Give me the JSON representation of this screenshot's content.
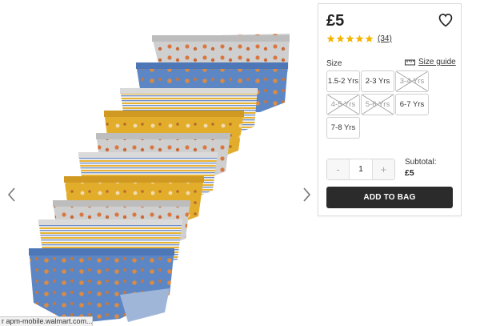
{
  "product": {
    "price": "£5",
    "rating": 5,
    "review_count": "(34)"
  },
  "size": {
    "label": "Size",
    "guide_label": "Size guide",
    "options": [
      {
        "label": "1.5-2 Yrs",
        "available": true
      },
      {
        "label": "2-3 Yrs",
        "available": true
      },
      {
        "label": "3-4 Yrs",
        "available": false
      },
      {
        "label": "4-5 Yrs",
        "available": false
      },
      {
        "label": "5-6 Yrs",
        "available": false
      },
      {
        "label": "6-7 Yrs",
        "available": true
      },
      {
        "label": "7-8 Yrs",
        "available": true
      }
    ]
  },
  "quantity": {
    "minus": "-",
    "value": "1",
    "plus": "+"
  },
  "subtotal": {
    "label": "Subtotal:",
    "value": "£5"
  },
  "add_to_bag_label": "ADD TO BAG",
  "status_bar_text": "r apm-mobile.walmart.com...",
  "colors": {
    "star": "#f5b400",
    "button_dark": "#2b2b2b",
    "border": "#dedede"
  },
  "icons": [
    "chevron-left-icon",
    "chevron-right-icon",
    "heart-outline-icon",
    "star-icon",
    "ruler-icon"
  ]
}
